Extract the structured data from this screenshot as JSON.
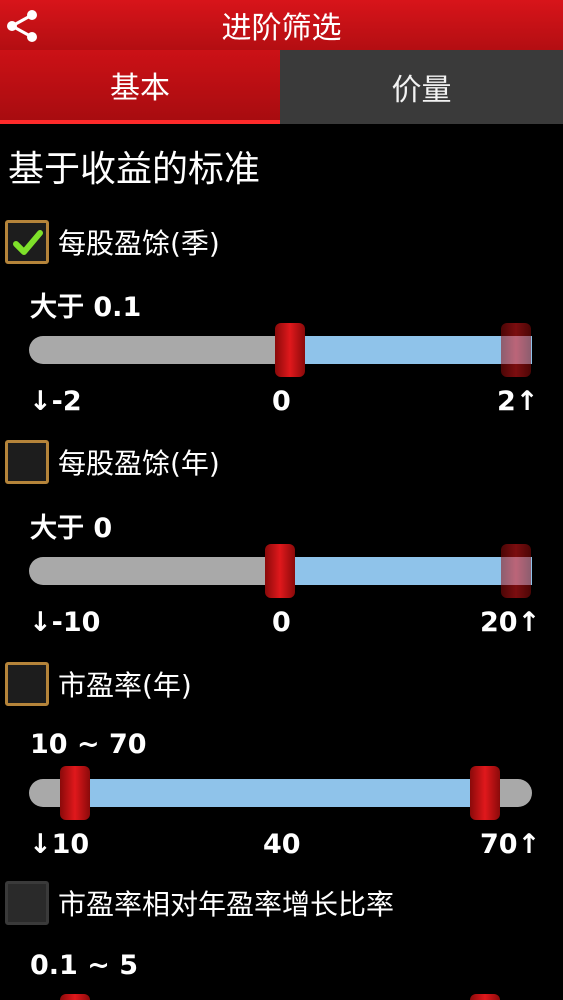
{
  "header": {
    "title": "进阶筛选",
    "icon": "share-icon"
  },
  "tabs": [
    {
      "label": "基本",
      "active": true
    },
    {
      "label": "价量",
      "active": false
    }
  ],
  "section_title": "基于收益的标准",
  "filters": [
    {
      "label": "每股盈馀(季)",
      "checked": true,
      "range_text": "大于 0.1",
      "min": "↓-2",
      "mid": "0",
      "max": "2↑",
      "low_value": 0.1,
      "high_value": 2
    },
    {
      "label": "每股盈馀(年)",
      "checked": false,
      "range_text": "大于 0",
      "min": "↓-10",
      "mid": "0",
      "max": "20↑",
      "low_value": 0,
      "high_value": 20
    },
    {
      "label": "市盈率(年)",
      "checked": false,
      "range_text": "10 ~ 70",
      "min": "↓10",
      "mid": "40",
      "max": "70↑",
      "low_value": 10,
      "high_value": 70
    },
    {
      "label": "市盈率相对年盈率增长比率",
      "checked": false,
      "range_text": "0.1 ~ 5"
    }
  ],
  "colors": {
    "accent": "#d8141a",
    "fill": "#8fc3ea",
    "track": "#a9a9a9"
  }
}
